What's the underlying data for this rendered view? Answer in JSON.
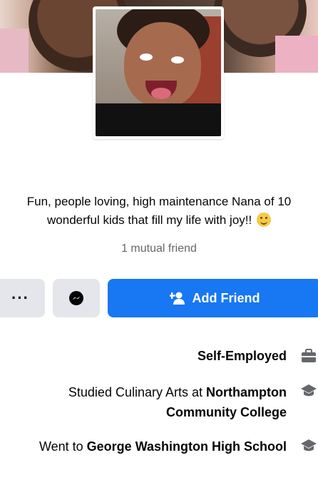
{
  "bio": {
    "line1": "Fun, people loving, high maintenance Nana of 10",
    "line2": "wonderful kids that fill my life with joy!!"
  },
  "mutual": "1 mutual friend",
  "actions": {
    "add_friend": "Add Friend",
    "more": "···"
  },
  "details": [
    {
      "icon": "briefcase-icon",
      "parts": [
        {
          "text": "Self-Employed",
          "bold": true
        }
      ]
    },
    {
      "icon": "graduation-cap-icon",
      "parts": [
        {
          "text": "Studied Culinary Arts at ",
          "bold": false
        },
        {
          "text": "Northampton Community College",
          "bold": true
        }
      ]
    },
    {
      "icon": "graduation-cap-icon",
      "parts": [
        {
          "text": "Went to ",
          "bold": false
        },
        {
          "text": "George Washington High School",
          "bold": true
        }
      ]
    }
  ],
  "colors": {
    "primary": "#1877f2",
    "secondary_button": "#e4e6eb",
    "muted_text": "#65676b"
  }
}
